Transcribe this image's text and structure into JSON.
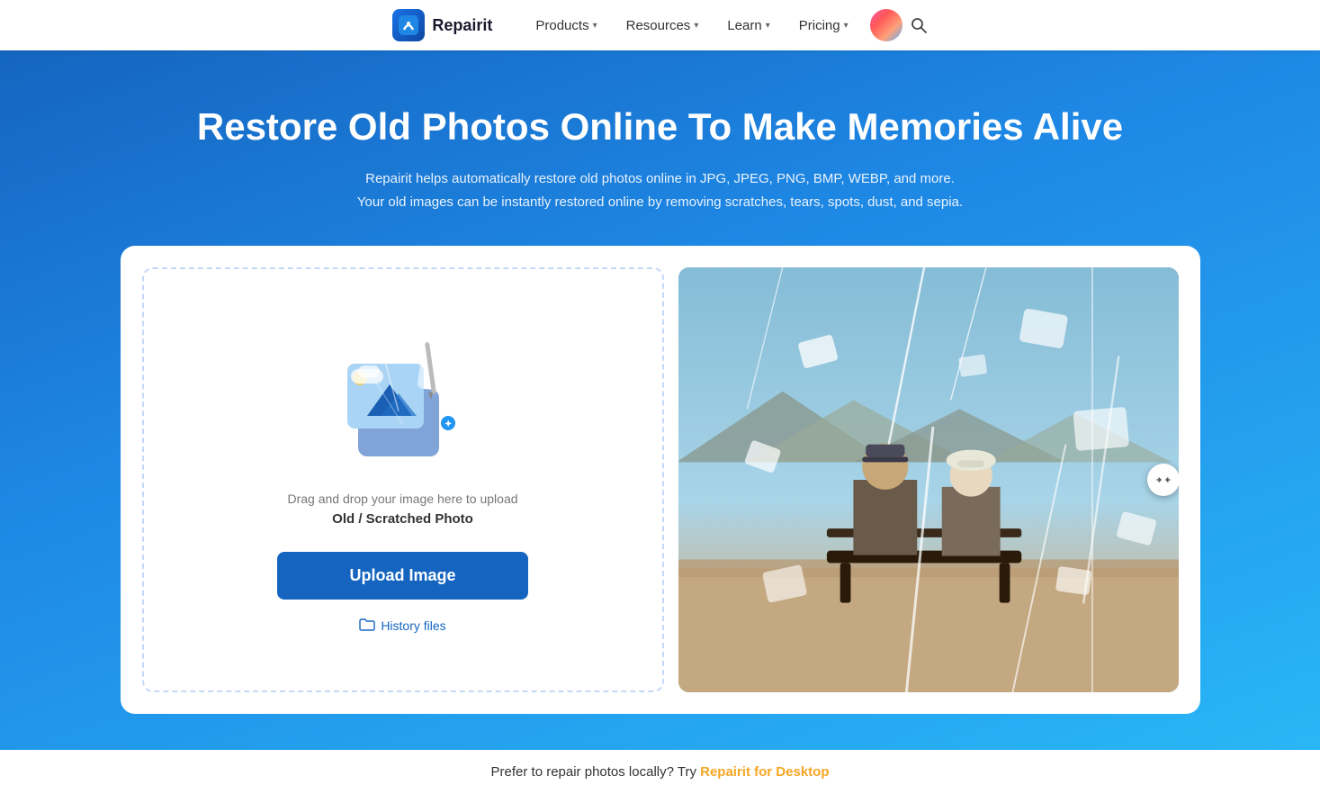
{
  "nav": {
    "logo_text": "Repairit",
    "items": [
      {
        "label": "Products",
        "has_chevron": true
      },
      {
        "label": "Resources",
        "has_chevron": true
      },
      {
        "label": "Learn",
        "has_chevron": true
      },
      {
        "label": "Pricing",
        "has_chevron": true
      }
    ],
    "search_label": "search"
  },
  "hero": {
    "title": "Restore Old Photos Online To Make Memories Alive",
    "subtitle_line1": "Repairit helps automatically restore old photos online in JPG, JPEG, PNG, BMP, WEBP, and more.",
    "subtitle_line2": "Your old images can be instantly restored online by removing scratches, tears, spots, dust, and sepia."
  },
  "upload_panel": {
    "drag_text": "Drag and drop your image here to upload",
    "photo_label": "Old / Scratched Photo",
    "upload_button_label": "Upload Image",
    "history_label": "History files"
  },
  "footer": {
    "text": "Prefer to repair photos locally? Try ",
    "link_text": "Repairit for Desktop"
  }
}
